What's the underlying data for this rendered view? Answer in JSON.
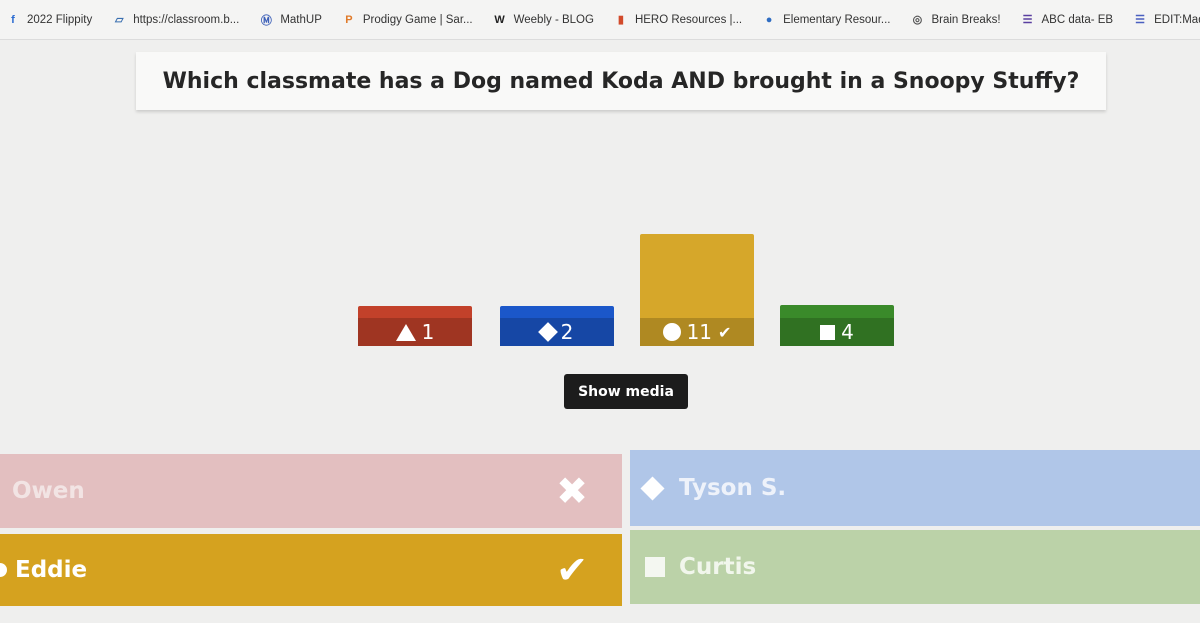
{
  "bookmarks": [
    {
      "label": "2022 Flippity",
      "icon": "flippity-icon",
      "glyph": "f",
      "color": "#2a6bd1"
    },
    {
      "label": "https://classroom.b...",
      "icon": "classroom-icon",
      "glyph": "▱",
      "color": "#3a6fb0"
    },
    {
      "label": "MathUP",
      "icon": "mathup-icon",
      "glyph": "Ⓜ",
      "color": "#3c5fb8"
    },
    {
      "label": "Prodigy Game | Sar...",
      "icon": "prodigy-icon",
      "glyph": "P",
      "color": "#e07a2a"
    },
    {
      "label": "Weebly - BLOG",
      "icon": "weebly-icon",
      "glyph": "W",
      "color": "#222222"
    },
    {
      "label": "HERO Resources |...",
      "icon": "hero-icon",
      "glyph": "▮",
      "color": "#d24a2a"
    },
    {
      "label": "Elementary Resour...",
      "icon": "elementary-icon",
      "glyph": "●",
      "color": "#2f6dc2"
    },
    {
      "label": "Brain Breaks!",
      "icon": "globe-icon",
      "glyph": "◎",
      "color": "#555555"
    },
    {
      "label": "ABC data- EB",
      "icon": "form-icon",
      "glyph": "☰",
      "color": "#5a3fa0"
    },
    {
      "label": "EDIT:Madter/Kehl...",
      "icon": "form-icon",
      "glyph": "☰",
      "color": "#4a5fc0"
    }
  ],
  "question": "Which classmate has a Dog named Koda AND brought in a Snoopy Stuffy?",
  "chart_data": {
    "type": "bar",
    "categories": [
      "triangle",
      "diamond",
      "circle",
      "square"
    ],
    "values": [
      1,
      2,
      11,
      4
    ],
    "labels": [
      "1",
      "2",
      "11",
      "4"
    ],
    "correct": "circle",
    "colors": [
      "#c2412a",
      "#1b57c9",
      "#d6a72a",
      "#3a8a2a"
    ]
  },
  "show_media_label": "Show media",
  "answers": {
    "owen": "Owen",
    "tyson": "Tyson S.",
    "eddie": "Eddie",
    "curtis": "Curtis"
  },
  "marks": {
    "wrong": "✖",
    "correct": "✔"
  }
}
